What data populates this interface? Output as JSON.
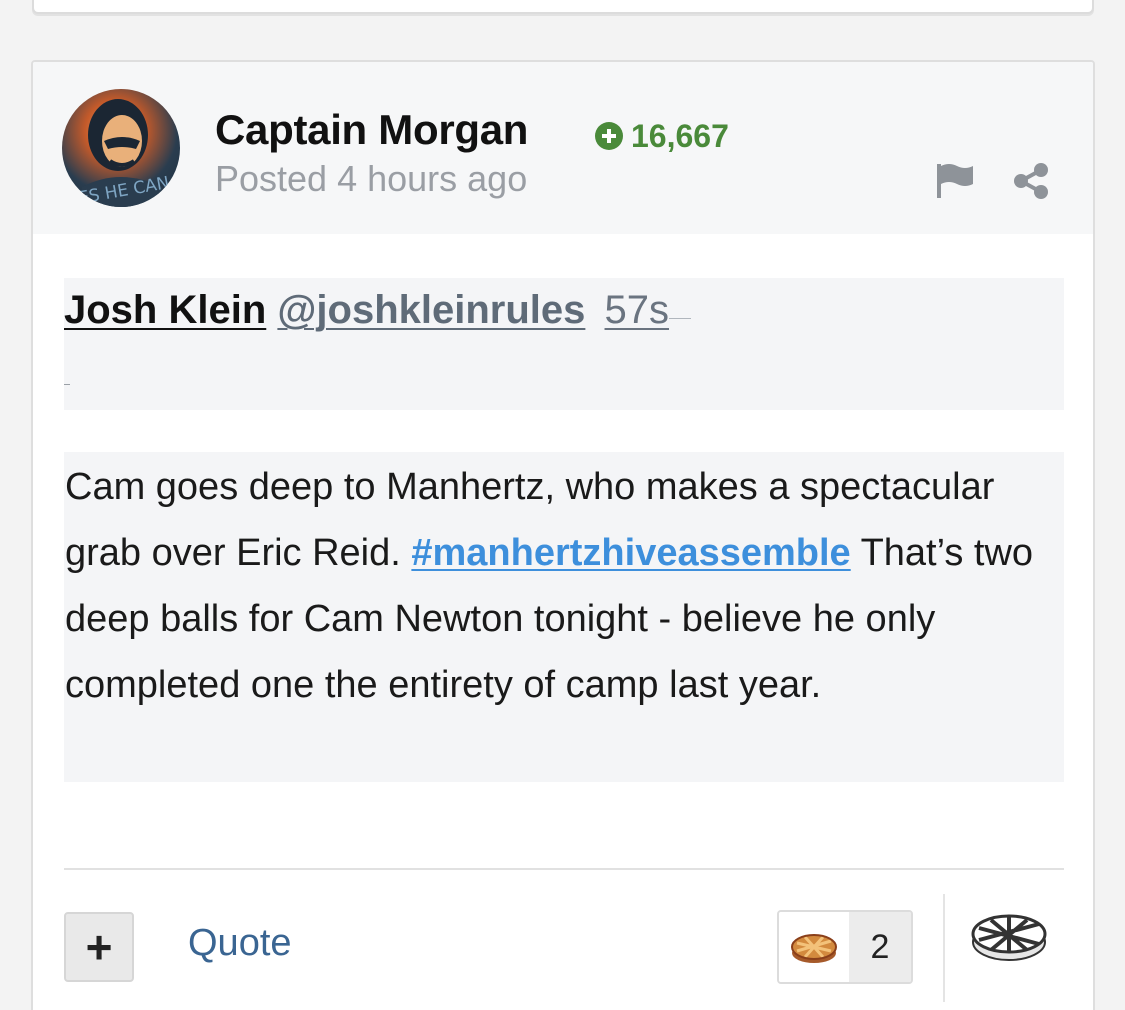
{
  "post": {
    "author": "Captain Morgan",
    "reputation": "16,667",
    "posted": "Posted 4 hours ago",
    "avatar_text": "YES HE CAN"
  },
  "tweet": {
    "name": "Josh Klein",
    "handle": "@joshkleinrules",
    "time": "57s",
    "body_before": "Cam goes deep to Manhertz, who makes a spectacular grab over Eric Reid. ",
    "hashtag": "#manhertzhiveassemble",
    "body_after": " That’s two deep balls for Cam Newton tonight - believe he only completed one the entirety of camp last year."
  },
  "footer": {
    "plus_glyph": "+",
    "quote_label": "Quote",
    "reaction_count": "2"
  },
  "icons": {
    "reputation": "plus-circle-icon",
    "flag": "flag-icon",
    "share": "share-icon",
    "reaction": "pie-icon",
    "reaction_trigger": "pie-outline-icon"
  },
  "colors": {
    "reputation": "#4a8a3a",
    "hashtag": "#3d8fdc",
    "quote": "#3a6592"
  }
}
